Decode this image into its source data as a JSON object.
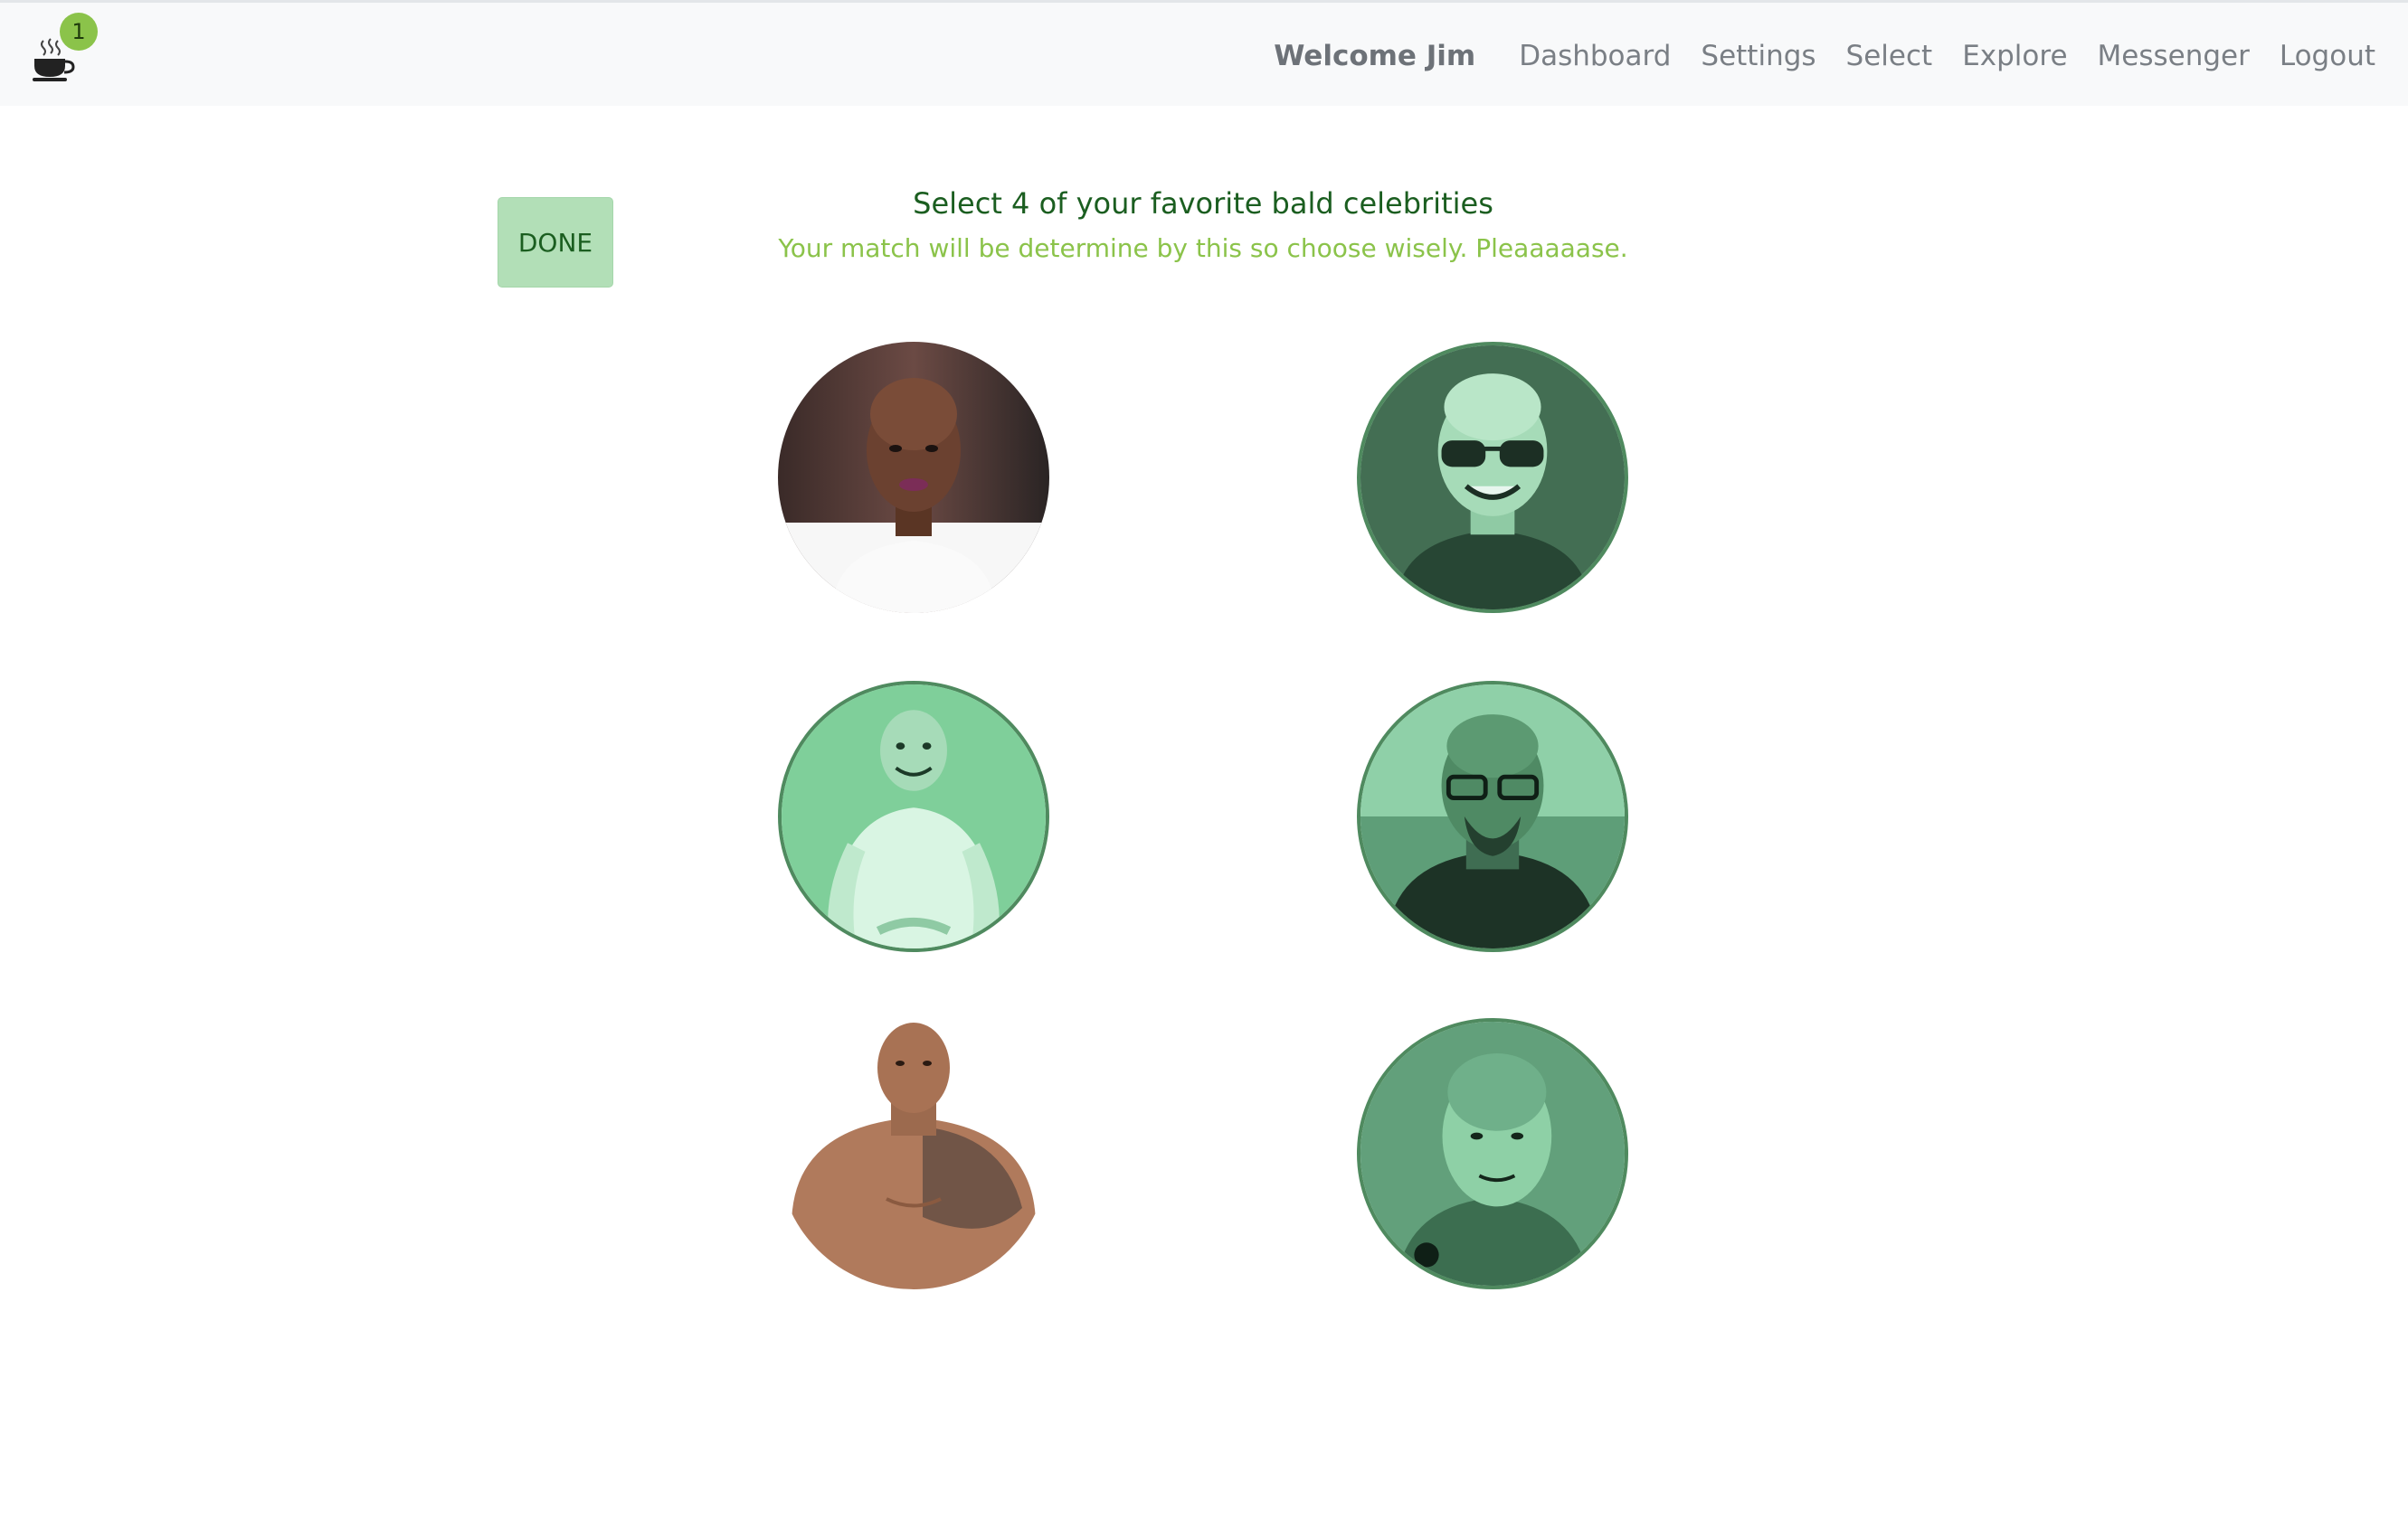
{
  "navbar": {
    "brand_icon": "coffee-cup-icon",
    "notification_count": "1",
    "welcome": "Welcome Jim",
    "links": [
      "Dashboard",
      "Settings",
      "Select",
      "Explore",
      "Messenger",
      "Logout"
    ]
  },
  "main": {
    "done_label": "DONE",
    "title": "Select 4 of your favorite bald celebrities",
    "subtitle": "Your match will be determine by this so choose wisely. Pleaaaaase."
  },
  "colors": {
    "accent_green": "#8bc34a",
    "dark_green": "#1b5e20",
    "selected_tint": "#7fcf9a"
  }
}
